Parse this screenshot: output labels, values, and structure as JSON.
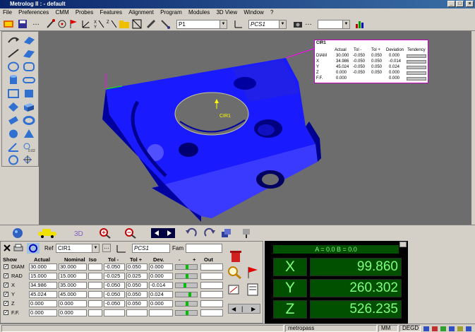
{
  "window": {
    "title": "Metrolog II : - default"
  },
  "menu": [
    "File",
    "Preferences",
    "CMM",
    "Probes",
    "Features",
    "Alignment",
    "Program",
    "Modules",
    "3D View",
    "Window",
    "?"
  ],
  "toolbar": {
    "probe_combo": "P1",
    "pcs_combo": "PCS1"
  },
  "viewport": {
    "feature_label": "CIR1",
    "mini_table": {
      "title": "CIR1",
      "headers": [
        "Actual",
        "Tol -",
        "Tol +",
        "Deviation",
        "Tendency"
      ],
      "rows": [
        {
          "name": "DIAM",
          "actual": "30.000",
          "tolm": "-0.050",
          "tolp": "0.050",
          "dev": "0.000"
        },
        {
          "name": "X",
          "actual": "34.986",
          "tolm": "-0.050",
          "tolp": "0.050",
          "dev": "-0.014"
        },
        {
          "name": "Y",
          "actual": "45.024",
          "tolm": "-0.050",
          "tolp": "0.050",
          "dev": "0.024"
        },
        {
          "name": "Z",
          "actual": "0.000",
          "tolm": "-0.050",
          "tolp": "0.050",
          "dev": "0.000"
        },
        {
          "name": "F.F.",
          "actual": "0.000",
          "tolm": "",
          "tolp": "",
          "dev": "0.000"
        }
      ]
    }
  },
  "feature_panel": {
    "ref_label": "Ref",
    "ref_value": "CIR1",
    "pcs_value": "PCS1",
    "fam_label": "Fam",
    "headers": [
      "Show",
      "Actual",
      "Nominal",
      "Iso",
      "Tol -",
      "Tol +",
      "Dev.",
      "-",
      "+",
      "Out"
    ],
    "rows": [
      {
        "name": "DIAM",
        "actual": "30.000",
        "nominal": "30.000",
        "tolm": "-0.050",
        "tolp": "0.050",
        "dev": "0.000",
        "tend": 0.5
      },
      {
        "name": "RAD",
        "actual": "15.000",
        "nominal": "15.000",
        "tolm": "-0.025",
        "tolp": "0.025",
        "dev": "0.000",
        "tend": 0.5
      },
      {
        "name": "X",
        "actual": "34.986",
        "nominal": "35.000",
        "tolm": "-0.050",
        "tolp": "0.050",
        "dev": "-0.014",
        "tend": 0.4
      },
      {
        "name": "Y",
        "actual": "45.024",
        "nominal": "45.000",
        "tolm": "-0.050",
        "tolp": "0.050",
        "dev": "0.024",
        "tend": 0.65
      },
      {
        "name": "Z",
        "actual": "0.000",
        "nominal": "0.000",
        "tolm": "-0.050",
        "tolp": "0.050",
        "dev": "0.000",
        "tend": 0.5
      },
      {
        "name": "F.F.",
        "actual": "0.000",
        "nominal": "0.000",
        "tolm": "",
        "tolp": "",
        "dev": "",
        "tend": 0.5
      }
    ]
  },
  "dro": {
    "angles": "A = 0.0  B = 0.0",
    "axes": [
      {
        "label": "X",
        "value": "99.860"
      },
      {
        "label": "Y",
        "value": "260.302"
      },
      {
        "label": "Z",
        "value": "526.235"
      }
    ]
  },
  "statusbar": {
    "user": "metropass",
    "units": "MM",
    "angle_units": "DEGD"
  },
  "colors": {
    "part": "#1a1aff",
    "viewport_bg": "#6d6d6d",
    "dro_green": "#7dff7d"
  }
}
